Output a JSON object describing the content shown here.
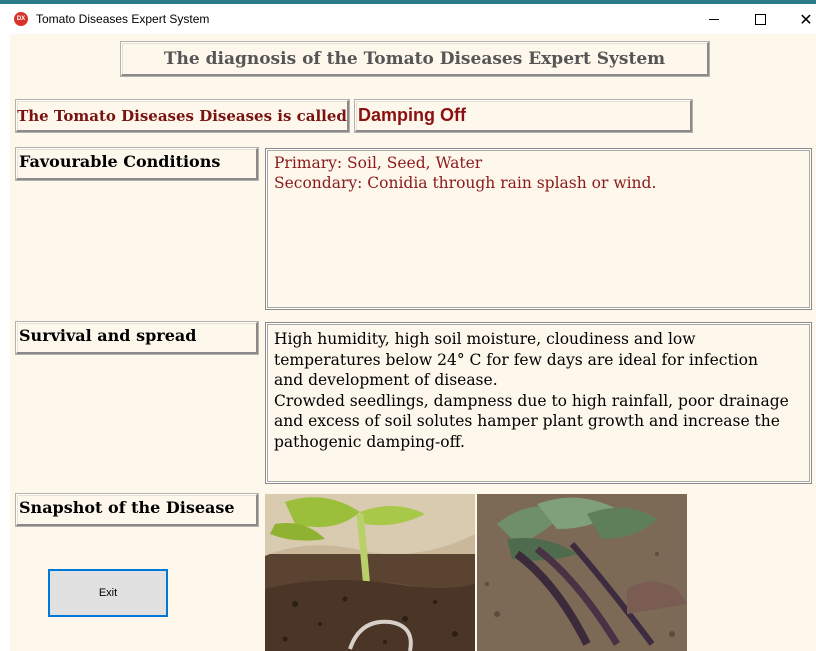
{
  "window": {
    "title": "Tomato Diseases Expert System",
    "icon_label": "DX",
    "close_glyph": "✕"
  },
  "heading": "The diagnosis of the Tomato Diseases Expert System",
  "disease": {
    "label": "The Tomato Diseases Diseases is called",
    "name": "Damping Off"
  },
  "favourable_conditions": {
    "label": "Favourable Conditions",
    "lines": [
      "Primary: Soil, Seed, Water",
      "Secondary: Conidia through rain splash or wind."
    ]
  },
  "survival_spread": {
    "label": "Survival and spread",
    "lines": [
      "High humidity, high soil moisture, cloudiness and low",
      "temperatures below 24° C for few days are ideal for infection",
      "and development of disease.",
      "Crowded seedlings, dampness due to high rainfall, poor drainage",
      "and excess of soil solutes hamper plant growth and increase the",
      "pathogenic damping-off."
    ]
  },
  "snapshot": {
    "label": "Snapshot of the Disease"
  },
  "buttons": {
    "exit": "Exit"
  },
  "colors": {
    "background": "#fdf7ec",
    "accent_red": "#8b1010",
    "title_bar_accent": "#2a7a8a",
    "exit_border": "#0078d7"
  },
  "icons": [
    "app-icon",
    "minimize-icon",
    "maximize-icon",
    "close-icon"
  ]
}
